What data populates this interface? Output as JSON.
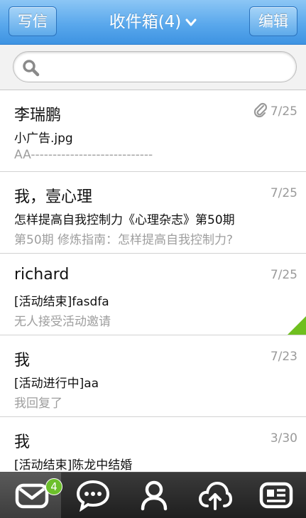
{
  "header": {
    "compose_label": "写信",
    "title": "收件箱(4)",
    "edit_label": "编辑"
  },
  "search": {
    "placeholder": ""
  },
  "messages": [
    {
      "sender": "李瑞鹏",
      "date": "7/25",
      "subject": "小广告.jpg",
      "preview": "AA----------------------------",
      "has_attachment": true,
      "flagged": false
    },
    {
      "sender": "我，壹心理",
      "date": "7/25",
      "subject": "怎样提高自我控制力《心理杂志》第50期",
      "preview": "第50期 修炼指南：怎样提高自我控制力?",
      "has_attachment": false,
      "flagged": false
    },
    {
      "sender": "richard",
      "date": "7/25",
      "subject": "[活动结束]fasdfa",
      "preview": "无人接受活动邀请",
      "has_attachment": false,
      "flagged": true
    },
    {
      "sender": "我",
      "date": "7/23",
      "subject": "[活动进行中]aa",
      "preview": "我回复了",
      "has_attachment": false,
      "flagged": false
    },
    {
      "sender": "我",
      "date": "3/30",
      "subject": "[活动结束]陈龙中结婚",
      "preview": "",
      "has_attachment": false,
      "flagged": false
    }
  ],
  "tabbar": {
    "items": [
      {
        "icon": "mail-icon",
        "badge": "4",
        "active": true
      },
      {
        "icon": "chat-icon"
      },
      {
        "icon": "contacts-icon"
      },
      {
        "icon": "cloud-upload-icon"
      },
      {
        "icon": "card-icon"
      }
    ]
  },
  "colors": {
    "header_blue": "#5aa8ec",
    "flag_green": "#6fbf1f",
    "badge_green": "#6cbf2b"
  }
}
